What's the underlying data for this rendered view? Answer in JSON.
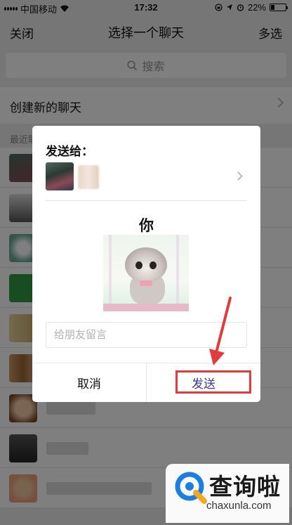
{
  "status_bar": {
    "carrier": "中国移动",
    "time": "17:32",
    "battery": "22%"
  },
  "nav": {
    "close": "关闭",
    "title": "选择一个聊天",
    "multi_select": "多选"
  },
  "search": {
    "placeholder": "搜索"
  },
  "create_chat": {
    "label": "创建新的聊天"
  },
  "recent_header": "最近聊天",
  "dialog": {
    "title": "发送给：",
    "caption": "你",
    "message_placeholder": "给朋友留言",
    "cancel": "取消",
    "send": "发送"
  },
  "watermark": {
    "brand": "查询啦",
    "url": "chaxunla.com"
  },
  "colors": {
    "highlight": "#e23b3b",
    "send_text": "#3a3a8e",
    "logo_blue": "#1a7fe0",
    "logo_orange": "#f5a623"
  },
  "icons": [
    "wifi-icon",
    "search-icon",
    "chevron-right-icon",
    "alarm-icon",
    "location-icon",
    "lock-rotation-icon"
  ]
}
